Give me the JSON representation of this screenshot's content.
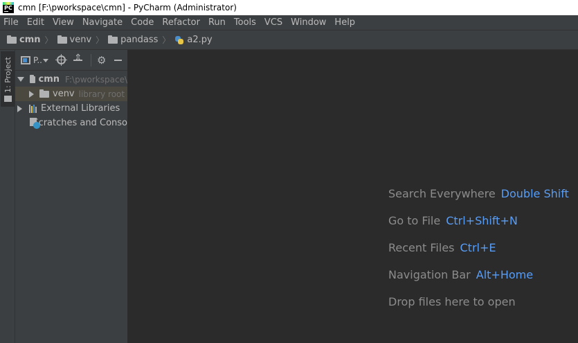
{
  "window": {
    "title": "cmn [F:\\pworkspace\\cmn] - PyCharm (Administrator)",
    "app_icon_text": "PC"
  },
  "menu": [
    "File",
    "Edit",
    "View",
    "Navigate",
    "Code",
    "Refactor",
    "Run",
    "Tools",
    "VCS",
    "Window",
    "Help"
  ],
  "breadcrumb": [
    {
      "label": "cmn",
      "icon": "folder-icon"
    },
    {
      "label": "venv",
      "icon": "folder-icon"
    },
    {
      "label": "pandass",
      "icon": "folder-icon"
    },
    {
      "label": "a2.py",
      "icon": "python-file-icon"
    }
  ],
  "tool_stripe": {
    "project_tab": "1: Project"
  },
  "project_panel": {
    "view_label": "P..",
    "tree": [
      {
        "label": "cmn",
        "path": "F:\\pworkspace\\",
        "expanded": true
      },
      {
        "label": "venv",
        "note": "library root",
        "expanded": false,
        "selected": true
      },
      {
        "label": "External Libraries",
        "expanded": false
      },
      {
        "label": "Scratches and Conso"
      }
    ]
  },
  "editor": {
    "hints": [
      {
        "text": "Search Everywhere",
        "shortcut": "Double Shift"
      },
      {
        "text": "Go to File",
        "shortcut": "Ctrl+Shift+N"
      },
      {
        "text": "Recent Files",
        "shortcut": "Ctrl+E"
      },
      {
        "text": "Navigation Bar",
        "shortcut": "Alt+Home"
      },
      {
        "text": "Drop files here to open",
        "shortcut": ""
      }
    ]
  },
  "colors": {
    "shortcut": "#589df6",
    "panel": "#3c3f41",
    "editor_bg": "#2b2b2b",
    "selection": "#4b483f"
  }
}
